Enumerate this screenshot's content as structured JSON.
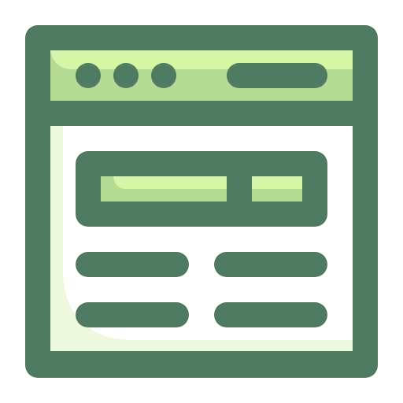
{
  "icon": {
    "name": "browser-window-icon",
    "colors": {
      "outline": "#4E7B61",
      "titlebar_fill": "#B6DB95",
      "titlebar_highlight": "#D7F5A8",
      "content_fill": "#FFFFFF",
      "content_shade": "#EEF8DF",
      "search_fill": "#B6DB95",
      "search_highlight": "#D7F5A8"
    },
    "window_dots_count": 3,
    "text_lines_count": 4
  }
}
